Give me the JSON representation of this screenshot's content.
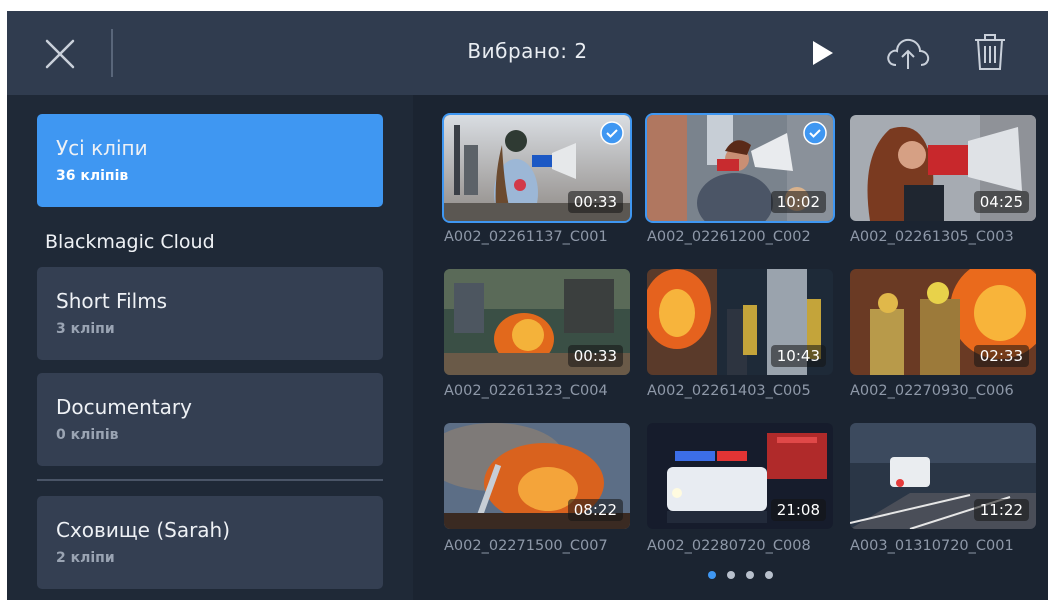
{
  "header": {
    "title": "Вибрано: 2",
    "icons": [
      "close-icon",
      "play-icon",
      "cloud-upload-icon",
      "trash-icon"
    ]
  },
  "sidebar": {
    "all_clips": {
      "title": "Усі кліпи",
      "count": "36 кліпів"
    },
    "section_label": "Blackmagic Cloud",
    "projects": [
      {
        "title": "Short Films",
        "count": "3 кліпи"
      },
      {
        "title": "Documentary",
        "count": "0 кліпів"
      }
    ],
    "storage": {
      "title": "Сховище (Sarah)",
      "count": "2 кліпи"
    }
  },
  "clips": [
    {
      "name": "A002_02261137_C001",
      "duration": "00:33",
      "selected": true
    },
    {
      "name": "A002_02261200_C002",
      "duration": "10:02",
      "selected": true
    },
    {
      "name": "A002_02261305_C003",
      "duration": "04:25",
      "selected": false
    },
    {
      "name": "A002_02261323_C004",
      "duration": "00:33",
      "selected": false
    },
    {
      "name": "A002_02261403_C005",
      "duration": "10:43",
      "selected": false
    },
    {
      "name": "A002_02270930_C006",
      "duration": "02:33",
      "selected": false
    },
    {
      "name": "A002_02271500_C007",
      "duration": "08:22",
      "selected": false
    },
    {
      "name": "A002_02280720_C008",
      "duration": "21:08",
      "selected": false
    },
    {
      "name": "A003_01310720_C001",
      "duration": "11:22",
      "selected": false
    }
  ],
  "pagination": {
    "pages": 4,
    "current": 1
  },
  "colors": {
    "accent": "#3f97f2",
    "topbar": "#303c4f",
    "background": "#1b2431",
    "card": "#343f52"
  }
}
